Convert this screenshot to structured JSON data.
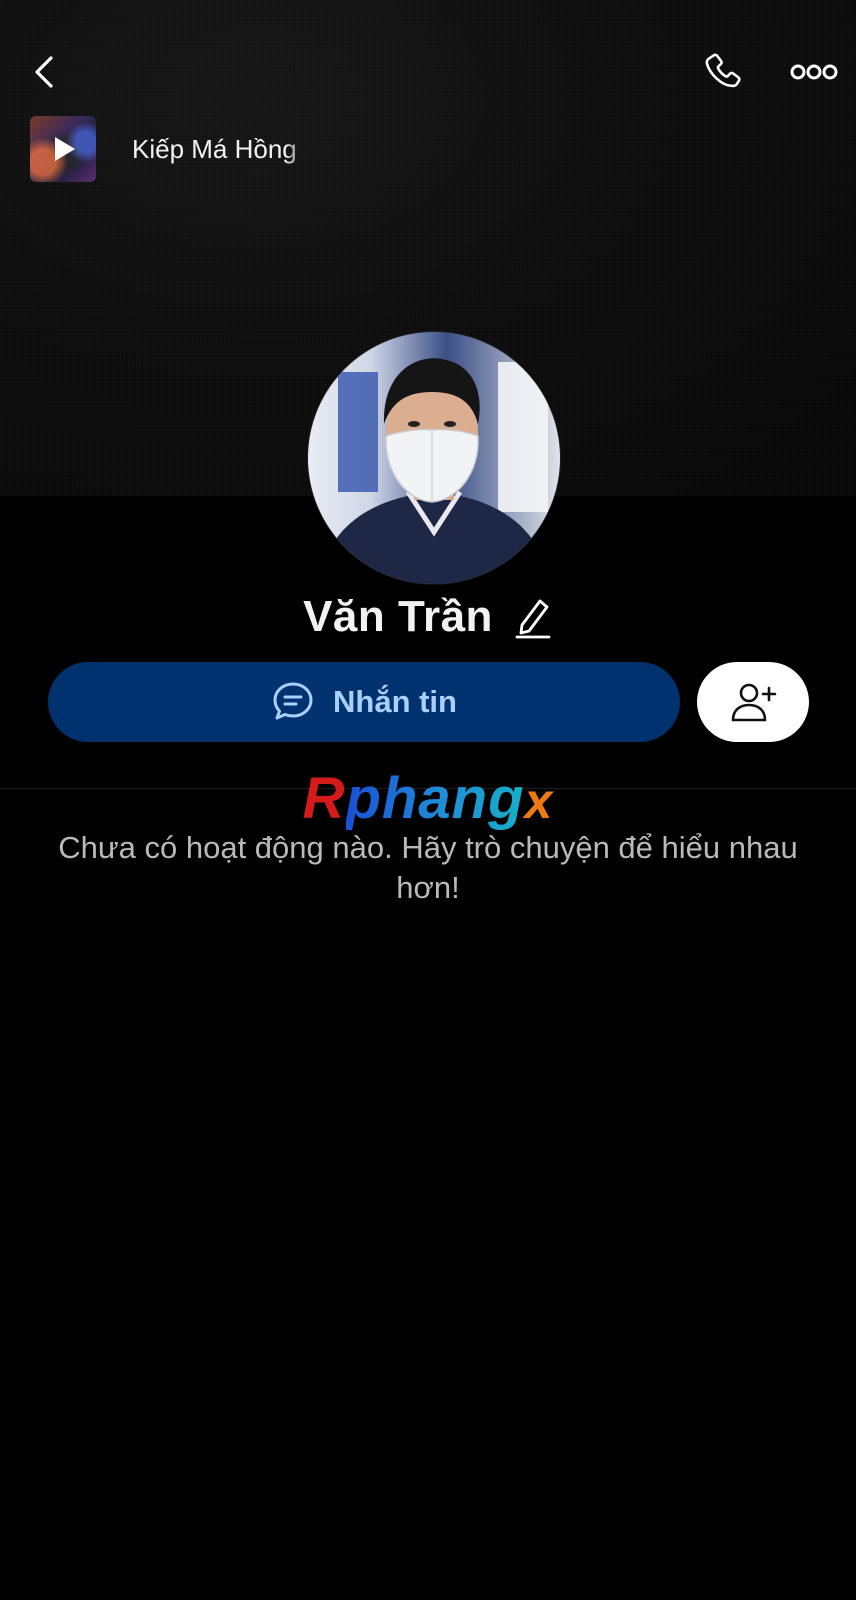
{
  "header": {
    "back_icon": "chevron-left-icon",
    "call_icon": "phone-icon",
    "more_icon": "more-dots-icon"
  },
  "music": {
    "title": "Kiếp Má Hồng",
    "play_icon": "play-icon"
  },
  "profile": {
    "name": "Văn Trần",
    "edit_icon": "pencil-icon",
    "avatar_icon": "avatar"
  },
  "actions": {
    "message_label": "Nhắn tin",
    "message_icon": "chat-bubble-icon",
    "add_friend_icon": "add-friend-icon"
  },
  "watermark": {
    "r": "R",
    "phang": "phang",
    "x": "x"
  },
  "empty_state": {
    "text": "Chưa có hoạt động nào. Hãy trò chuyện để hiểu nhau hơn!"
  },
  "colors": {
    "background": "#000000",
    "message_button_bg": "#00326f",
    "message_button_text": "#a9d0ff",
    "add_friend_bg": "#ffffff",
    "muted_text": "#b9b9b9"
  }
}
